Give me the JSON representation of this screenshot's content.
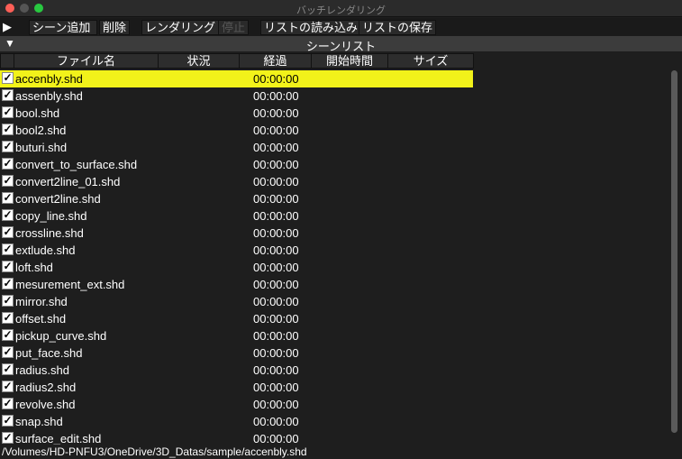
{
  "window": {
    "title": "バッチレンダリング"
  },
  "toolbar": {
    "play_icon": "▶",
    "add_scene": "シーン追加",
    "delete": "削除",
    "render": "レンダリング",
    "stop": "停止",
    "load_list": "リストの読み込み",
    "save_list": "リストの保存"
  },
  "section": {
    "toggle_icon": "▼",
    "title": "シーンリスト"
  },
  "columns": [
    "ファイル名",
    "状況",
    "経過",
    "開始時間",
    "サイズ"
  ],
  "rows": [
    {
      "name": "accenbly.shd",
      "elapsed": "00:00:00"
    },
    {
      "name": "assenbly.shd",
      "elapsed": "00:00:00"
    },
    {
      "name": "bool.shd",
      "elapsed": "00:00:00"
    },
    {
      "name": "bool2.shd",
      "elapsed": "00:00:00"
    },
    {
      "name": "buturi.shd",
      "elapsed": "00:00:00"
    },
    {
      "name": "convert_to_surface.shd",
      "elapsed": "00:00:00"
    },
    {
      "name": "convert2line_01.shd",
      "elapsed": "00:00:00"
    },
    {
      "name": "convert2line.shd",
      "elapsed": "00:00:00"
    },
    {
      "name": "copy_line.shd",
      "elapsed": "00:00:00"
    },
    {
      "name": "crossline.shd",
      "elapsed": "00:00:00"
    },
    {
      "name": "extlude.shd",
      "elapsed": "00:00:00"
    },
    {
      "name": "loft.shd",
      "elapsed": "00:00:00"
    },
    {
      "name": "mesurement_ext.shd",
      "elapsed": "00:00:00"
    },
    {
      "name": "mirror.shd",
      "elapsed": "00:00:00"
    },
    {
      "name": "offset.shd",
      "elapsed": "00:00:00"
    },
    {
      "name": "pickup_curve.shd",
      "elapsed": "00:00:00"
    },
    {
      "name": "put_face.shd",
      "elapsed": "00:00:00"
    },
    {
      "name": "radius.shd",
      "elapsed": "00:00:00"
    },
    {
      "name": "radius2.shd",
      "elapsed": "00:00:00"
    },
    {
      "name": "revolve.shd",
      "elapsed": "00:00:00"
    },
    {
      "name": "snap.shd",
      "elapsed": "00:00:00"
    },
    {
      "name": "surface_edit.shd",
      "elapsed": "00:00:00"
    }
  ],
  "status": {
    "path": "/Volumes/HD-PNFU3/OneDrive/3D_Datas/sample/accenbly.shd"
  },
  "colors": {
    "selected_row": "#f2f21a"
  }
}
